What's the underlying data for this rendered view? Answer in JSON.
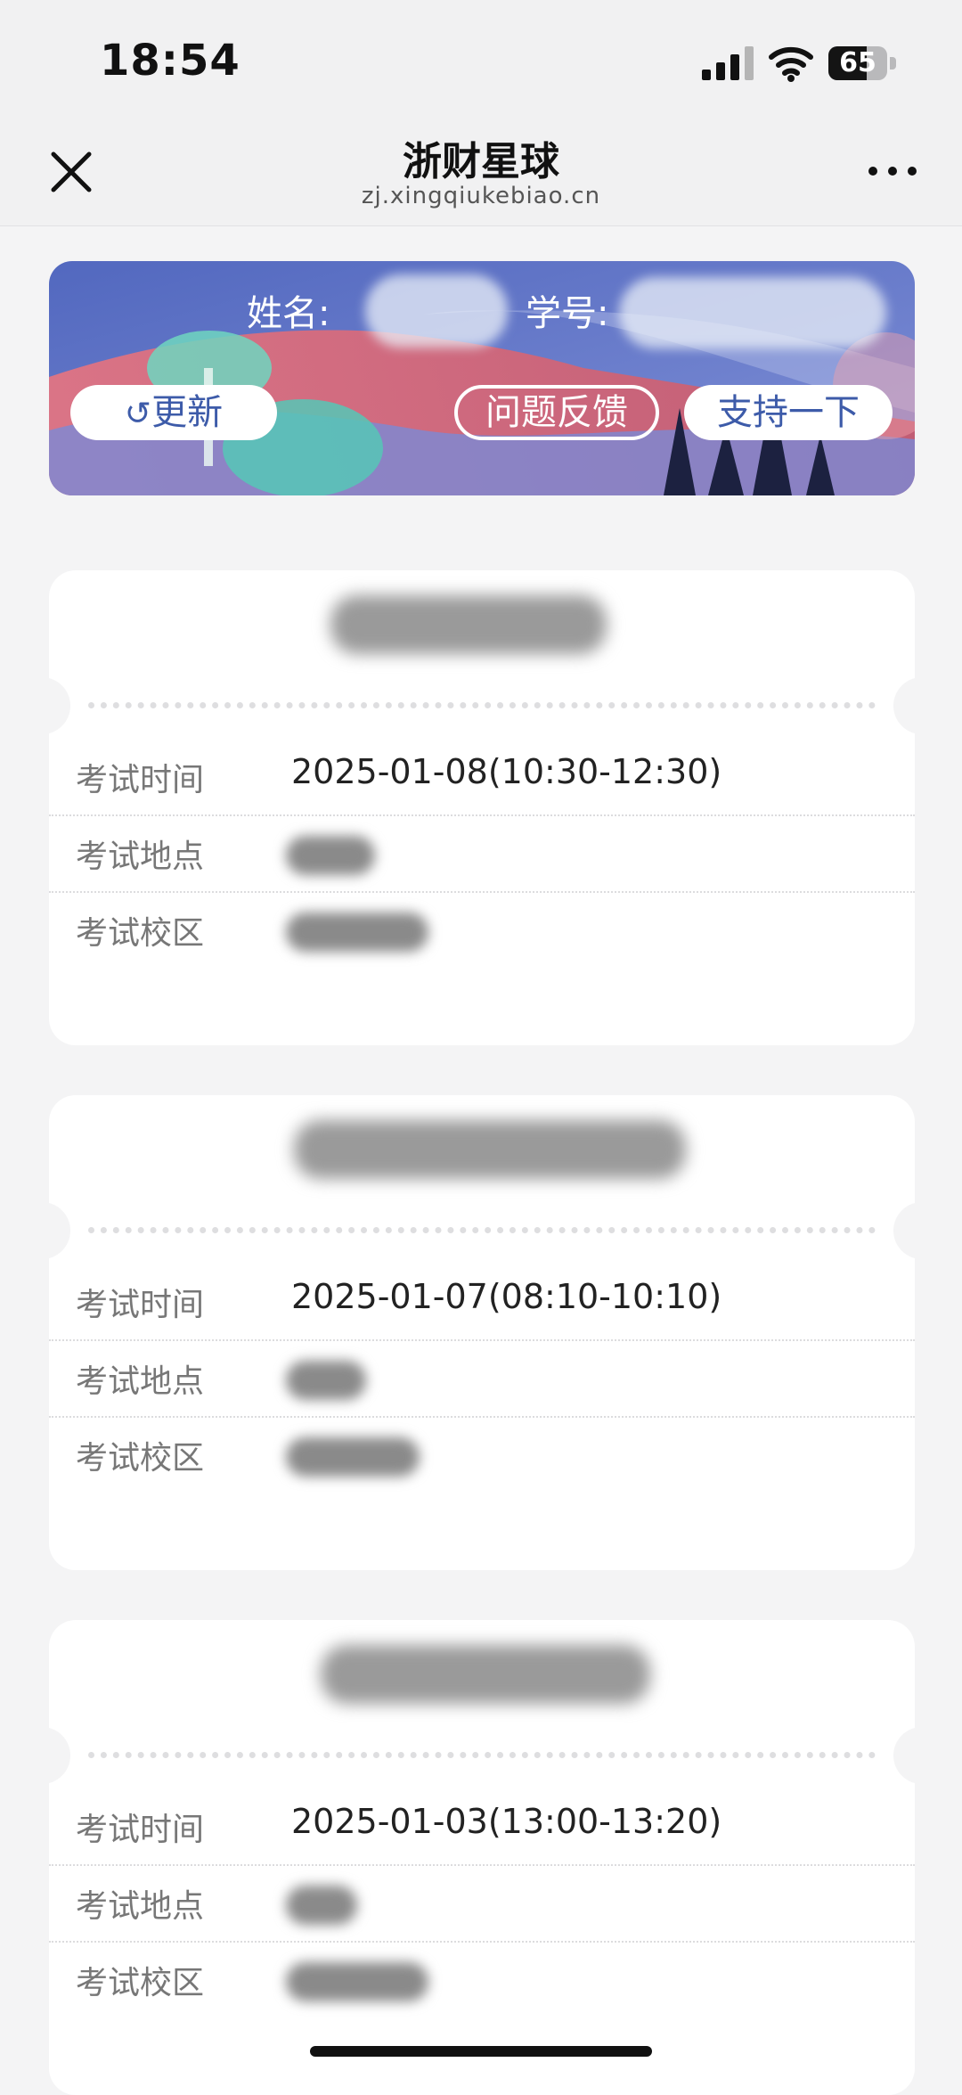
{
  "status_bar": {
    "time": "18:54",
    "battery_level": "65",
    "battery_fraction": 0.65
  },
  "nav": {
    "title": "浙财星球",
    "url": "zj.xingqiukebiao.cn",
    "icons": {
      "close": "close-icon",
      "more": "more-icon"
    }
  },
  "banner": {
    "name_label": "姓名:",
    "student_id_label": "学号:",
    "refresh_label": "更新",
    "feedback_label": "问题反馈",
    "support_label": "支持一下",
    "colors": {
      "sky": "#5a6fc4",
      "mountain": "#e06a78",
      "accent": "#3d5ba9"
    }
  },
  "exams": [
    {
      "time_label": "考试时间",
      "time_value": "2025-01-08(10:30-12:30)",
      "location_label": "考试地点",
      "campus_label": "考试校区"
    },
    {
      "time_label": "考试时间",
      "time_value": "2025-01-07(08:10-10:10)",
      "location_label": "考试地点",
      "campus_label": "考试校区"
    },
    {
      "time_label": "考试时间",
      "time_value": "2025-01-03(13:00-13:20)",
      "location_label": "考试地点",
      "campus_label": "考试校区"
    }
  ]
}
